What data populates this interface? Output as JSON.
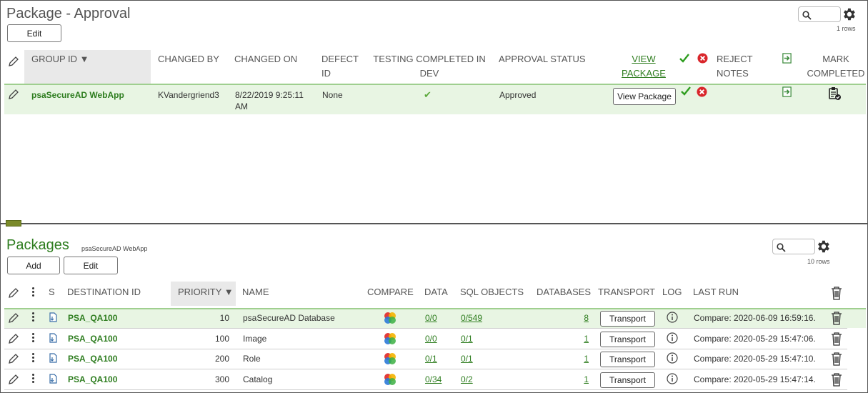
{
  "top": {
    "title": "Package - Approval",
    "edit_label": "Edit",
    "rows_count": "1 rows",
    "columns": {
      "group_id": "GROUP ID ▼",
      "changed_by": "CHANGED BY",
      "changed_on": "CHANGED ON",
      "defect_id_1": "DEFECT",
      "defect_id_2": "ID",
      "testing_1": "TESTING COMPLETED IN",
      "testing_2": "DEV",
      "approval_status": "APPROVAL STATUS",
      "view_package_1": "VIEW",
      "view_package_2": "PACKAGE",
      "reject_notes_1": "REJECT",
      "reject_notes_2": "NOTES",
      "mark_completed_1": "MARK",
      "mark_completed_2": "COMPLETED"
    },
    "row": {
      "group_id": "psaSecureAD WebApp",
      "changed_by": "KVandergriend3",
      "changed_on_1": "8/22/2019 9:25:11",
      "changed_on_2": "AM",
      "defect_id": "None",
      "testing_check": "✔",
      "approval_status": "Approved",
      "view_package_button": "View Package"
    }
  },
  "bottom": {
    "title": "Packages",
    "subtitle": "psaSecureAD WebApp",
    "add_label": "Add",
    "edit_label": "Edit",
    "rows_count": "10 rows",
    "columns": {
      "s": "S",
      "destination_id": "DESTINATION ID",
      "priority": "PRIORITY ▼",
      "name": "NAME",
      "compare": "COMPARE",
      "data": "DATA",
      "sql_objects": "SQL OBJECTS",
      "databases": "DATABASES",
      "transport": "TRANSPORT",
      "log": "LOG",
      "last_run": "LAST RUN"
    },
    "rows": [
      {
        "destination": "PSA_QA100",
        "priority": "10",
        "name": "psaSecureAD Database",
        "data": "0/0",
        "sql_objects": "0/549",
        "databases": "8",
        "transport": "Transport",
        "last_run": "Compare: 2020-06-09 16:59:16."
      },
      {
        "destination": "PSA_QA100",
        "priority": "100",
        "name": "Image",
        "data": "0/0",
        "sql_objects": "0/1",
        "databases": "1",
        "transport": "Transport",
        "last_run": "Compare: 2020-05-29 15:47:06."
      },
      {
        "destination": "PSA_QA100",
        "priority": "200",
        "name": "Role",
        "data": "0/1",
        "sql_objects": "0/1",
        "databases": "1",
        "transport": "Transport",
        "last_run": "Compare: 2020-05-29 15:47:10."
      },
      {
        "destination": "PSA_QA100",
        "priority": "300",
        "name": "Catalog",
        "data": "0/34",
        "sql_objects": "0/2",
        "databases": "1",
        "transport": "Transport",
        "last_run": "Compare: 2020-05-29 15:47:14."
      }
    ]
  },
  "colors": {
    "accent_green": "#2e7d1f",
    "selected_row": "#e8f5e3",
    "divider": "#7a8a2a"
  }
}
